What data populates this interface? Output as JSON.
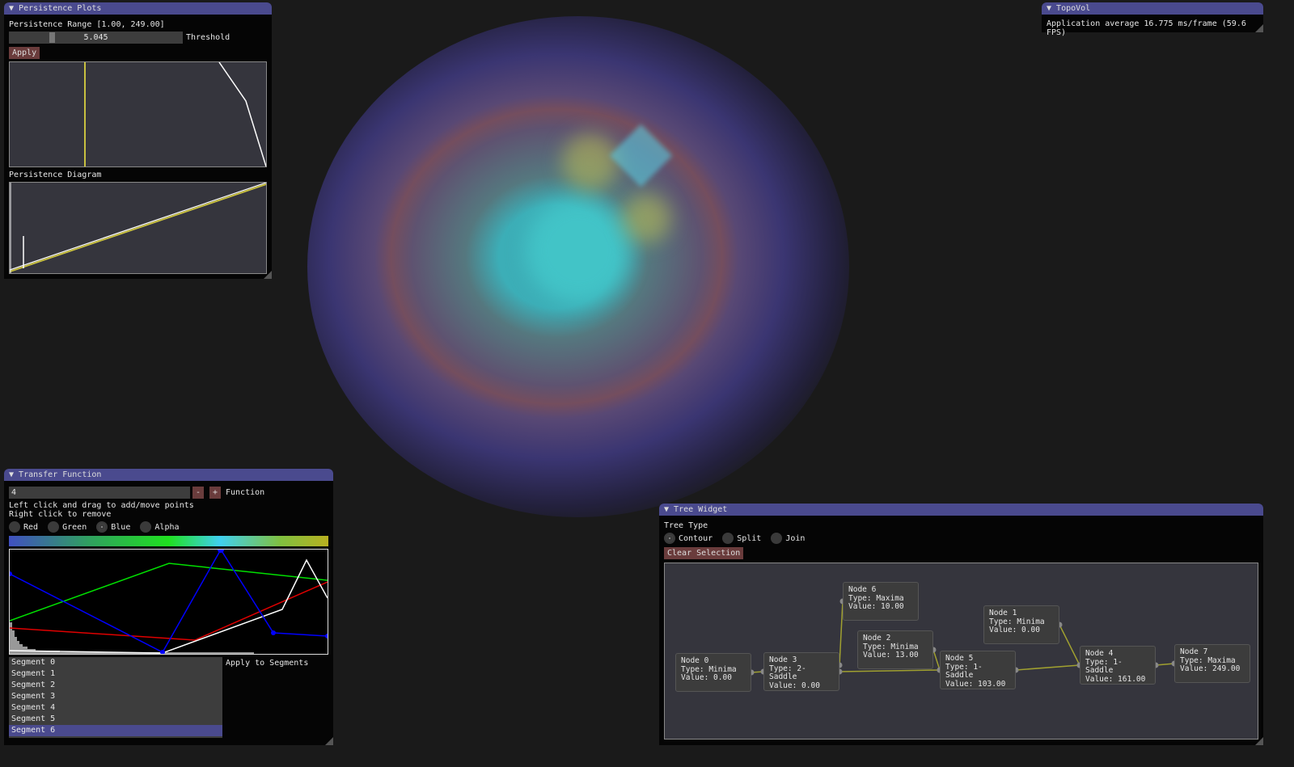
{
  "persistence": {
    "title": "Persistence Plots",
    "range_label": "Persistence Range [1.00, 249.00]",
    "slider_value": "5.045",
    "slider_fraction": 0.23,
    "slider_label": "Threshold",
    "apply": "Apply",
    "diagram_label": "Persistence Diagram"
  },
  "topovol": {
    "title": "TopoVol",
    "fps_text": "Application average 16.775 ms/frame (59.6 FPS)"
  },
  "transfer": {
    "title": "Transfer Function",
    "input_value": "4",
    "minus": "-",
    "plus": "+",
    "function_label": "Function",
    "help1": "Left click and drag to add/move points",
    "help2": "Right click to remove",
    "channels": [
      {
        "label": "Red",
        "selected": false
      },
      {
        "label": "Green",
        "selected": false
      },
      {
        "label": "Blue",
        "selected": true
      },
      {
        "label": "Alpha",
        "selected": false
      }
    ],
    "segments": [
      "Segment 0",
      "Segment 1",
      "Segment 2",
      "Segment 3",
      "Segment 4",
      "Segment 5",
      "Segment 6"
    ],
    "selected_segment": 6,
    "apply_segments": "Apply to Segments"
  },
  "tree": {
    "title": "Tree Widget",
    "type_label": "Tree Type",
    "types": [
      {
        "label": "Contour",
        "selected": true
      },
      {
        "label": "Split",
        "selected": false
      },
      {
        "label": "Join",
        "selected": false
      }
    ],
    "clear": "Clear Selection",
    "nodes": [
      {
        "name": "Node 0",
        "type": "Type: Minima",
        "value": "Value: 0.00"
      },
      {
        "name": "Node 1",
        "type": "Type: Minima",
        "value": "Value: 0.00"
      },
      {
        "name": "Node 2",
        "type": "Type: Minima",
        "value": "Value: 13.00"
      },
      {
        "name": "Node 3",
        "type": "Type: 2-Saddle",
        "value": "Value: 0.00"
      },
      {
        "name": "Node 4",
        "type": "Type: 1-Saddle",
        "value": "Value: 161.00"
      },
      {
        "name": "Node 5",
        "type": "Type: 1-Saddle",
        "value": "Value: 103.00"
      },
      {
        "name": "Node 6",
        "type": "Type: Maxima",
        "value": "Value: 10.00"
      },
      {
        "name": "Node 7",
        "type": "Type: Maxima",
        "value": "Value: 249.00"
      }
    ],
    "edges": [
      [
        0,
        3
      ],
      [
        3,
        6
      ],
      [
        3,
        5
      ],
      [
        2,
        5
      ],
      [
        5,
        4
      ],
      [
        1,
        4
      ],
      [
        4,
        7
      ]
    ]
  },
  "colors": {
    "title_bar": "#4a4a8e",
    "button": "#6a3c3c",
    "edge": "#a0a030"
  }
}
